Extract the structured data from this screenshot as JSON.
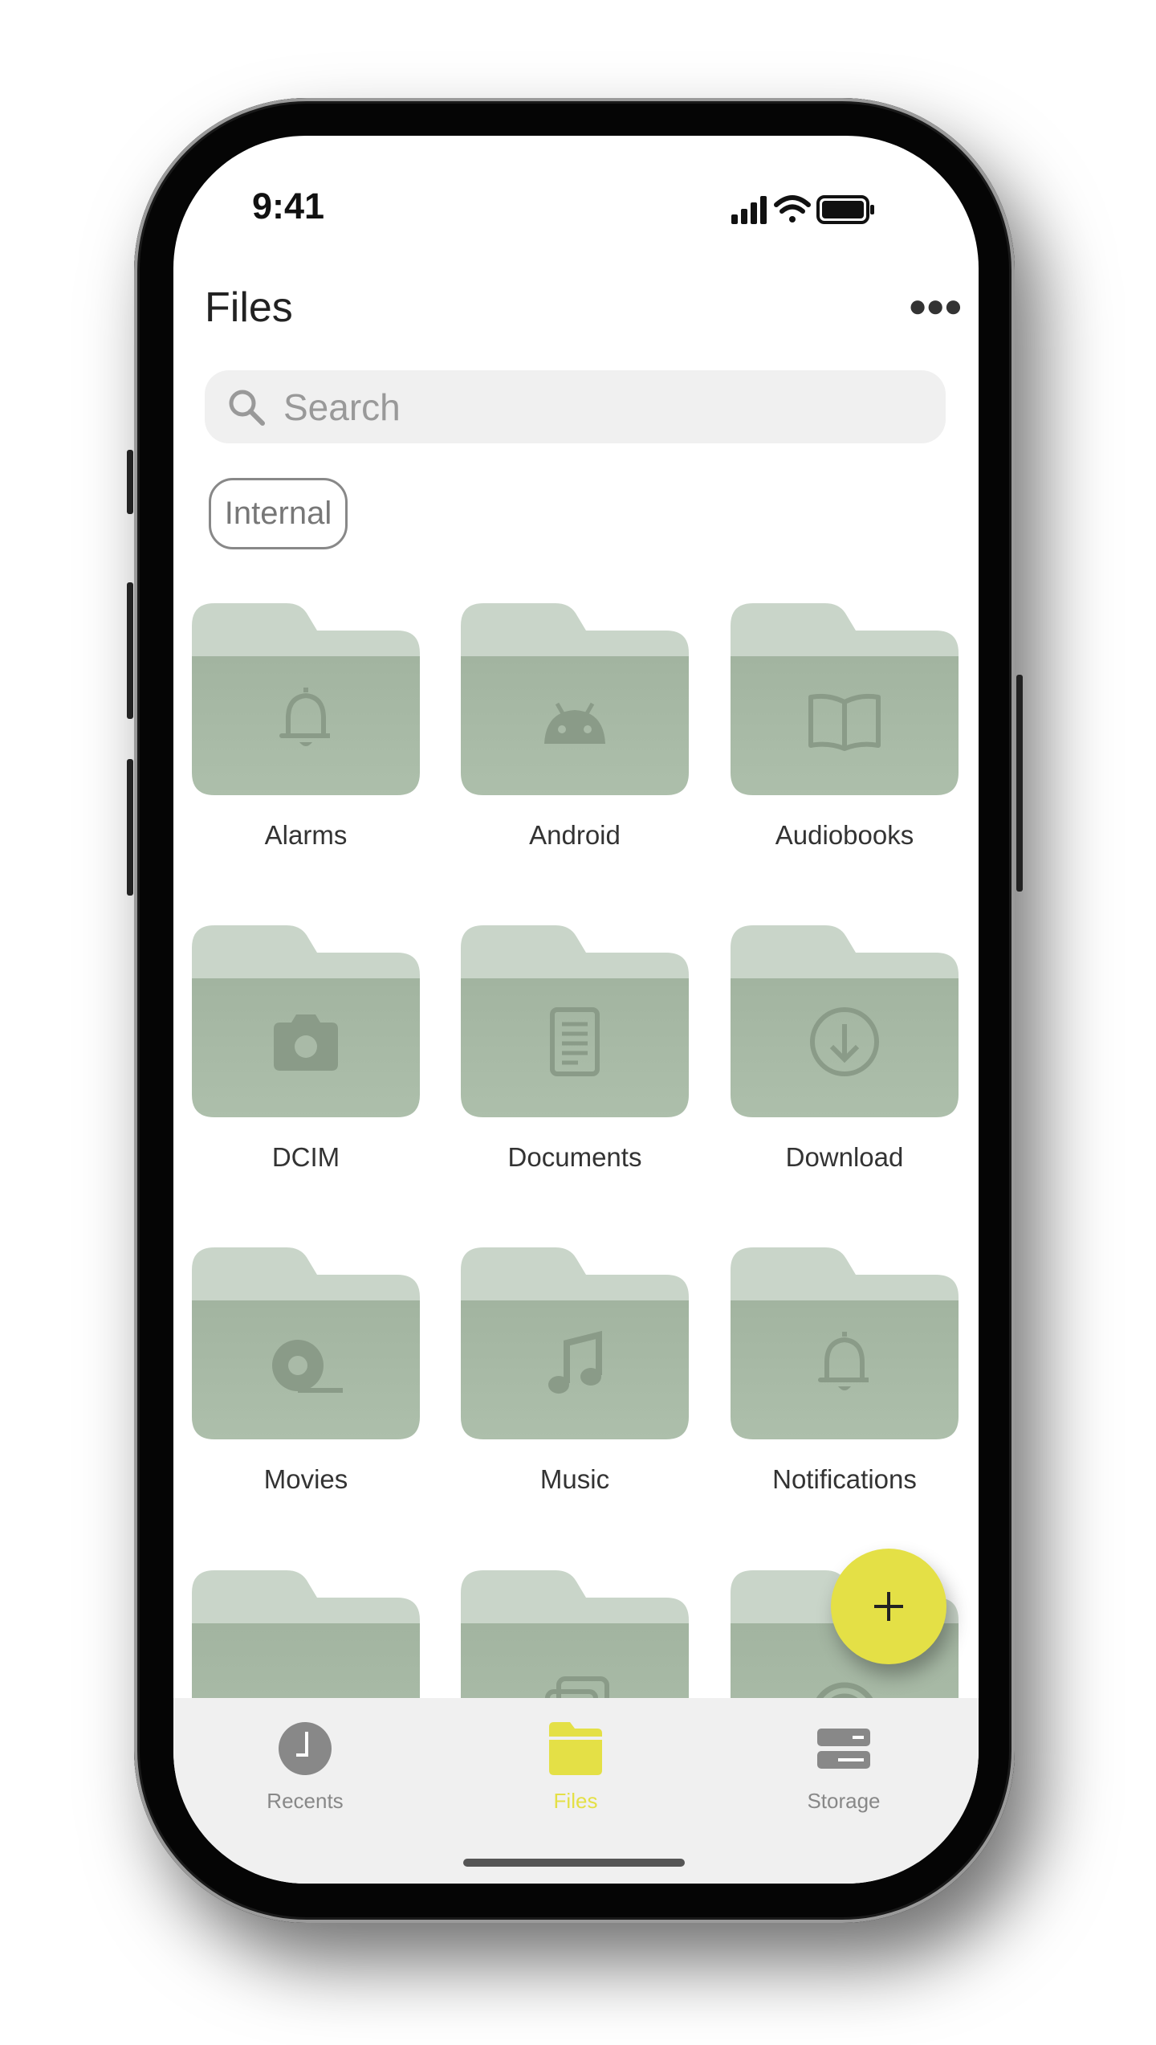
{
  "status_bar": {
    "time": "9:41",
    "icons": [
      "signal-icon",
      "wifi-icon",
      "battery-icon"
    ]
  },
  "header": {
    "title": "Files",
    "more_icon": "more-horizontal-icon"
  },
  "search": {
    "placeholder": "Search",
    "value": ""
  },
  "storage_chip": {
    "label": "Internal"
  },
  "folders": [
    {
      "label": "Alarms",
      "icon": "bell-icon"
    },
    {
      "label": "Android",
      "icon": "android-icon"
    },
    {
      "label": "Audiobooks",
      "icon": "book-icon"
    },
    {
      "label": "DCIM",
      "icon": "camera-icon"
    },
    {
      "label": "Documents",
      "icon": "document-icon"
    },
    {
      "label": "Download",
      "icon": "download-icon"
    },
    {
      "label": "Movies",
      "icon": "movie-reel-icon"
    },
    {
      "label": "Music",
      "icon": "music-note-icon"
    },
    {
      "label": "Notifications",
      "icon": "bell-icon"
    },
    {
      "label": "",
      "icon": ""
    },
    {
      "label": "",
      "icon": "photos-icon"
    },
    {
      "label": "",
      "icon": "podcast-icon"
    }
  ],
  "fab": {
    "icon": "plus-icon"
  },
  "bottom_nav": [
    {
      "label": "Recents",
      "icon": "clock-icon",
      "active": false
    },
    {
      "label": "Files",
      "icon": "folder-icon",
      "active": true
    },
    {
      "label": "Storage",
      "icon": "storage-icon",
      "active": false
    }
  ],
  "colors": {
    "accent": "#e4e046",
    "folder_tab": "#c9d5c9",
    "folder_body": "#a4b6a2",
    "folder_icon": "#8a9b88",
    "inactive": "#888888"
  }
}
